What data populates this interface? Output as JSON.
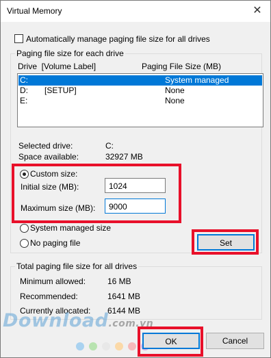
{
  "window": {
    "title": "Virtual Memory",
    "close_glyph": "✕"
  },
  "auto_manage": {
    "label": "Automatically manage paging file size for all drives",
    "checked": false
  },
  "paging_group": {
    "legend": "Paging file size for each drive",
    "col_drive": "Drive  [Volume Label]",
    "col_size": "Paging File Size (MB)",
    "rows": [
      {
        "drive": "C:",
        "label": "",
        "size": "System managed",
        "selected": true
      },
      {
        "drive": "D:",
        "label": "[SETUP]",
        "size": "None",
        "selected": false
      },
      {
        "drive": "E:",
        "label": "",
        "size": "None",
        "selected": false
      }
    ],
    "selected_drive_label": "Selected drive:",
    "selected_drive_value": "C:",
    "space_label": "Space available:",
    "space_value": "32927 MB",
    "custom_size_label": "Custom size:",
    "initial_label": "Initial size (MB):",
    "initial_value": "1024",
    "maximum_label": "Maximum size (MB):",
    "maximum_value": "9000",
    "system_managed_label": "System managed size",
    "no_paging_label": "No paging file",
    "set_label": "Set"
  },
  "total_group": {
    "legend": "Total paging file size for all drives",
    "min_label": "Minimum allowed:",
    "min_value": "16 MB",
    "rec_label": "Recommended:",
    "rec_value": "1641 MB",
    "cur_label": "Currently allocated:",
    "cur_value": "6144 MB"
  },
  "buttons": {
    "ok": "OK",
    "cancel": "Cancel"
  },
  "watermark": {
    "text": "Download",
    "suffix": ".com.vn"
  },
  "colors": {
    "highlight": "#0078d7",
    "annotation": "#e8102a"
  }
}
